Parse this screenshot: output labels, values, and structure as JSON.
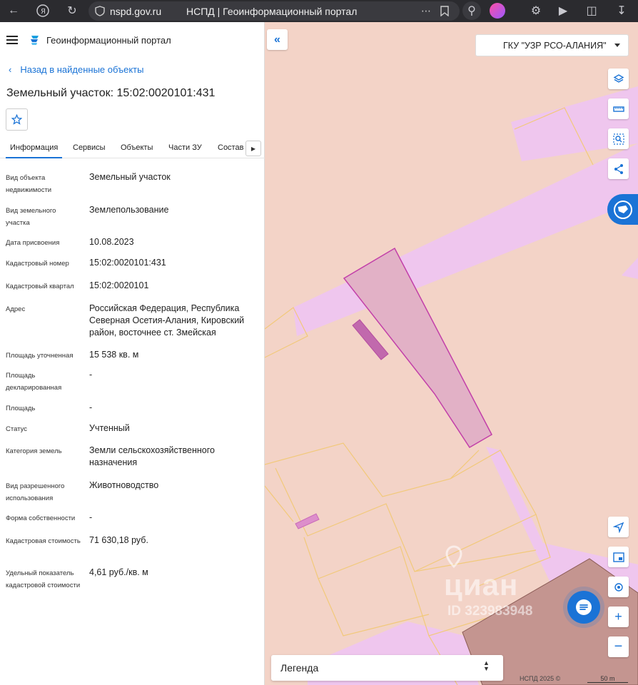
{
  "browser": {
    "url": "nspd.gov.ru",
    "tab_title": "НСПД | Геоинформационный портал"
  },
  "header": {
    "portal_name": "Геоинформационный портал"
  },
  "back_link": "Назад в найденные объекты",
  "page_title": "Земельный участок: 15:02:0020101:431",
  "tabs": [
    "Информация",
    "Сервисы",
    "Объекты",
    "Части ЗУ",
    "Состав"
  ],
  "active_tab": "Информация",
  "info": [
    {
      "label": "Вид объекта недвижимости",
      "value": "Земельный участок"
    },
    {
      "label": "Вид земельного участка",
      "value": "Землепользование"
    },
    {
      "label": "Дата присвоения",
      "value": "10.08.2023"
    },
    {
      "label": "Кадастровый номер",
      "value": "15:02:0020101:431"
    },
    {
      "label": "Кадастровый квартал",
      "value": "15:02:0020101"
    },
    {
      "label": "Адрес",
      "value": "Российская Федерация, Республика Северная Осетия-Алания, Кировский район, восточнее ст. Змейская"
    },
    {
      "label": "Площадь уточненная",
      "value": "15 538 кв. м"
    },
    {
      "label": "Площадь декларированная",
      "value": "-"
    },
    {
      "label": "Площадь",
      "value": "-"
    },
    {
      "label": "Статус",
      "value": "Учтенный"
    },
    {
      "label": "Категория земель",
      "value": "Земли сельскохозяйственного назначения"
    },
    {
      "label": "Вид разрешенного использования",
      "value": "Животноводство"
    },
    {
      "label": "Форма собственности",
      "value": "-"
    },
    {
      "label": "Кадастровая стоимость",
      "value": "71 630,18 руб."
    },
    {
      "label": "Удельный показатель кадастровой стоимости",
      "value": "4,61 руб./кв. м"
    }
  ],
  "map": {
    "org_select": "ГКУ \"УЗР РСО-АЛАНИЯ\"",
    "legend": "Легенда",
    "attribution": "НСПД 2025 ©",
    "scale": "50 m",
    "watermark": "циан",
    "watermark_id": "ID 323983948"
  },
  "colors": {
    "accent": "#1a73d6",
    "map_background": "#f3d3c7",
    "road": "#efc6ee",
    "selected_parcel": "#e2b1c6"
  }
}
